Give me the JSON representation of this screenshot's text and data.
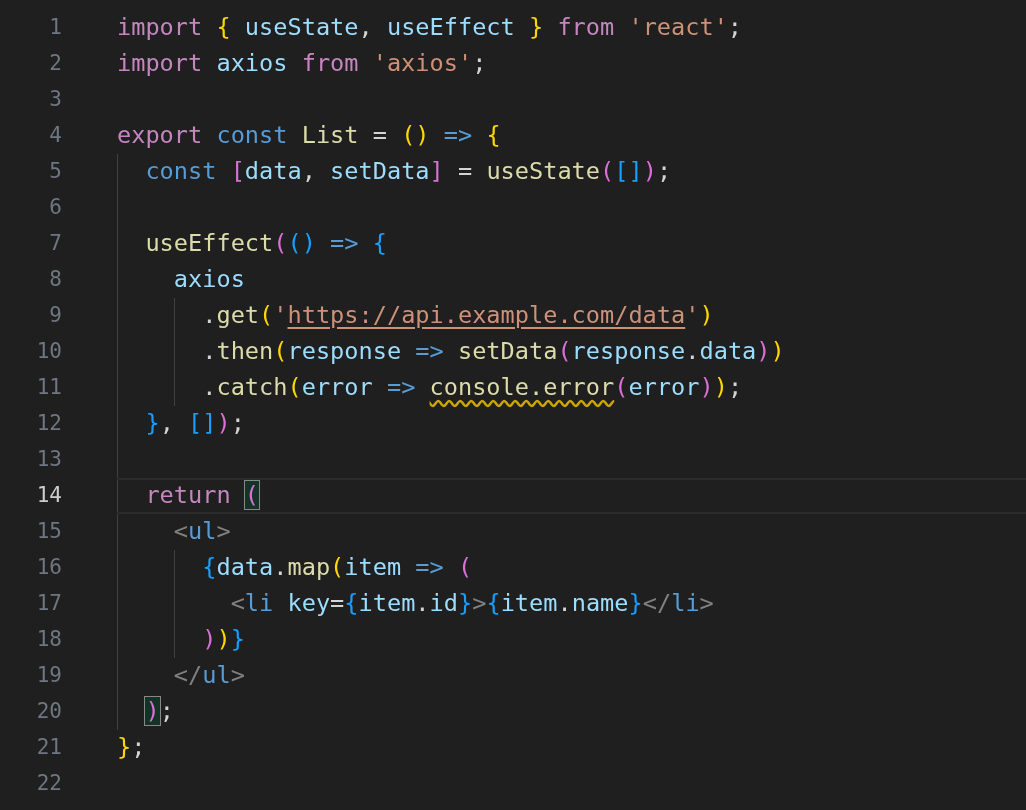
{
  "editor": {
    "lines": [
      {
        "number": "1",
        "current": false,
        "tokens": [
          {
            "text": "import ",
            "kind": "kw"
          },
          {
            "text": "{",
            "kind": "b1"
          },
          {
            "text": " useState",
            "kind": "var"
          },
          {
            "text": ", ",
            "kind": "p"
          },
          {
            "text": "useEffect ",
            "kind": "var"
          },
          {
            "text": "} ",
            "kind": "b1"
          },
          {
            "text": "from ",
            "kind": "kw"
          },
          {
            "text": "'react'",
            "kind": "str"
          },
          {
            "text": ";",
            "kind": "p"
          }
        ]
      },
      {
        "number": "2",
        "current": false,
        "tokens": [
          {
            "text": "import ",
            "kind": "kw"
          },
          {
            "text": "axios ",
            "kind": "var"
          },
          {
            "text": "from ",
            "kind": "kw"
          },
          {
            "text": "'axios'",
            "kind": "str"
          },
          {
            "text": ";",
            "kind": "p"
          }
        ]
      },
      {
        "number": "3",
        "current": false
      },
      {
        "number": "4",
        "current": false,
        "tokens": [
          {
            "text": "export ",
            "kind": "kw"
          },
          {
            "text": "const ",
            "kind": "st"
          },
          {
            "text": "List",
            "kind": "fn"
          },
          {
            "text": " = ",
            "kind": "p"
          },
          {
            "text": "() ",
            "kind": "b1"
          },
          {
            "text": "=> ",
            "kind": "st"
          },
          {
            "text": "{",
            "kind": "b1"
          }
        ]
      },
      {
        "number": "5",
        "current": false,
        "tokens": [
          {
            "text": "  const ",
            "kind": "st"
          },
          {
            "text": "[",
            "kind": "b2"
          },
          {
            "text": "data",
            "kind": "var"
          },
          {
            "text": ", ",
            "kind": "p"
          },
          {
            "text": "setData",
            "kind": "var"
          },
          {
            "text": "]",
            "kind": "b2"
          },
          {
            "text": " = ",
            "kind": "p"
          },
          {
            "text": "useState",
            "kind": "fn"
          },
          {
            "text": "(",
            "kind": "b2"
          },
          {
            "text": "[]",
            "kind": "b3"
          },
          {
            "text": ")",
            "kind": "b2"
          },
          {
            "text": ";",
            "kind": "p"
          }
        ]
      },
      {
        "number": "6",
        "current": false
      },
      {
        "number": "7",
        "current": false,
        "tokens": [
          {
            "text": "  useEffect",
            "kind": "fn"
          },
          {
            "text": "(",
            "kind": "b2"
          },
          {
            "text": "() ",
            "kind": "b3"
          },
          {
            "text": "=> ",
            "kind": "st"
          },
          {
            "text": "{",
            "kind": "b3"
          }
        ]
      },
      {
        "number": "8",
        "current": false,
        "tokens": [
          {
            "text": "    axios",
            "kind": "var"
          }
        ]
      },
      {
        "number": "9",
        "current": false,
        "tokens": [
          {
            "text": "      .",
            "kind": "p"
          },
          {
            "text": "get",
            "kind": "fn"
          },
          {
            "text": "(",
            "kind": "b1"
          },
          {
            "text": "'",
            "kind": "str"
          },
          {
            "text": "https://api.example.com/data",
            "kind": "link"
          },
          {
            "text": "'",
            "kind": "str"
          },
          {
            "text": ")",
            "kind": "b1"
          }
        ]
      },
      {
        "number": "10",
        "current": false,
        "tokens": [
          {
            "text": "      .",
            "kind": "p"
          },
          {
            "text": "then",
            "kind": "fn"
          },
          {
            "text": "(",
            "kind": "b1"
          },
          {
            "text": "response ",
            "kind": "var"
          },
          {
            "text": "=> ",
            "kind": "st"
          },
          {
            "text": "setData",
            "kind": "fn"
          },
          {
            "text": "(",
            "kind": "b2"
          },
          {
            "text": "response",
            "kind": "var"
          },
          {
            "text": ".",
            "kind": "p"
          },
          {
            "text": "data",
            "kind": "var"
          },
          {
            "text": ")",
            "kind": "b2"
          },
          {
            "text": ")",
            "kind": "b1"
          }
        ]
      },
      {
        "number": "11",
        "current": false,
        "tokens": [
          {
            "text": "      .",
            "kind": "p"
          },
          {
            "text": "catch",
            "kind": "fn"
          },
          {
            "text": "(",
            "kind": "b1"
          },
          {
            "text": "error ",
            "kind": "var"
          },
          {
            "text": "=> ",
            "kind": "st"
          },
          {
            "text": "console.error",
            "kind": "warning"
          },
          {
            "text": "(",
            "kind": "b2"
          },
          {
            "text": "error",
            "kind": "var"
          },
          {
            "text": ")",
            "kind": "b2"
          },
          {
            "text": ")",
            "kind": "b1"
          },
          {
            "text": ";",
            "kind": "p"
          }
        ]
      },
      {
        "number": "12",
        "current": false,
        "tokens": [
          {
            "text": "  }",
            "kind": "b3"
          },
          {
            "text": ", ",
            "kind": "p"
          },
          {
            "text": "[]",
            "kind": "b3"
          },
          {
            "text": ")",
            "kind": "b2"
          },
          {
            "text": ";",
            "kind": "p"
          }
        ]
      },
      {
        "number": "13",
        "current": false
      },
      {
        "number": "14",
        "current": true,
        "tokens": [
          {
            "text": "  return ",
            "kind": "kw"
          },
          {
            "text": "(",
            "kind": "matched"
          }
        ]
      },
      {
        "number": "15",
        "current": false,
        "tokens": [
          {
            "text": "    <",
            "kind": "tp"
          },
          {
            "text": "ul",
            "kind": "tag"
          },
          {
            "text": ">",
            "kind": "tp"
          }
        ]
      },
      {
        "number": "16",
        "current": false,
        "tokens": [
          {
            "text": "      {",
            "kind": "b3"
          },
          {
            "text": "data",
            "kind": "var"
          },
          {
            "text": ".",
            "kind": "p"
          },
          {
            "text": "map",
            "kind": "fn"
          },
          {
            "text": "(",
            "kind": "b1"
          },
          {
            "text": "item ",
            "kind": "var"
          },
          {
            "text": "=> ",
            "kind": "st"
          },
          {
            "text": "(",
            "kind": "b2"
          }
        ]
      },
      {
        "number": "17",
        "current": false,
        "tokens": [
          {
            "text": "        <",
            "kind": "tp"
          },
          {
            "text": "li ",
            "kind": "tag"
          },
          {
            "text": "key",
            "kind": "var"
          },
          {
            "text": "=",
            "kind": "p"
          },
          {
            "text": "{",
            "kind": "b3"
          },
          {
            "text": "item",
            "kind": "var"
          },
          {
            "text": ".",
            "kind": "p"
          },
          {
            "text": "id",
            "kind": "var"
          },
          {
            "text": "}",
            "kind": "b3"
          },
          {
            "text": ">",
            "kind": "tp"
          },
          {
            "text": "{",
            "kind": "b3"
          },
          {
            "text": "item",
            "kind": "var"
          },
          {
            "text": ".",
            "kind": "p"
          },
          {
            "text": "name",
            "kind": "var"
          },
          {
            "text": "}",
            "kind": "b3"
          },
          {
            "text": "</",
            "kind": "tp"
          },
          {
            "text": "li",
            "kind": "tag"
          },
          {
            "text": ">",
            "kind": "tp"
          }
        ]
      },
      {
        "number": "18",
        "current": false,
        "tokens": [
          {
            "text": "      )",
            "kind": "b2"
          },
          {
            "text": ")",
            "kind": "b1"
          },
          {
            "text": "}",
            "kind": "b3"
          }
        ]
      },
      {
        "number": "19",
        "current": false,
        "tokens": [
          {
            "text": "    </",
            "kind": "tp"
          },
          {
            "text": "ul",
            "kind": "tag"
          },
          {
            "text": ">",
            "kind": "tp"
          }
        ]
      },
      {
        "number": "20",
        "current": false,
        "tokens": [
          {
            "text": "  )",
            "kind": "matched"
          },
          {
            "text": ";",
            "kind": "p"
          }
        ]
      },
      {
        "number": "21",
        "current": false,
        "tokens": [
          {
            "text": "}",
            "kind": "b1"
          },
          {
            "text": ";",
            "kind": "p"
          }
        ]
      },
      {
        "number": "22",
        "current": false
      }
    ]
  }
}
